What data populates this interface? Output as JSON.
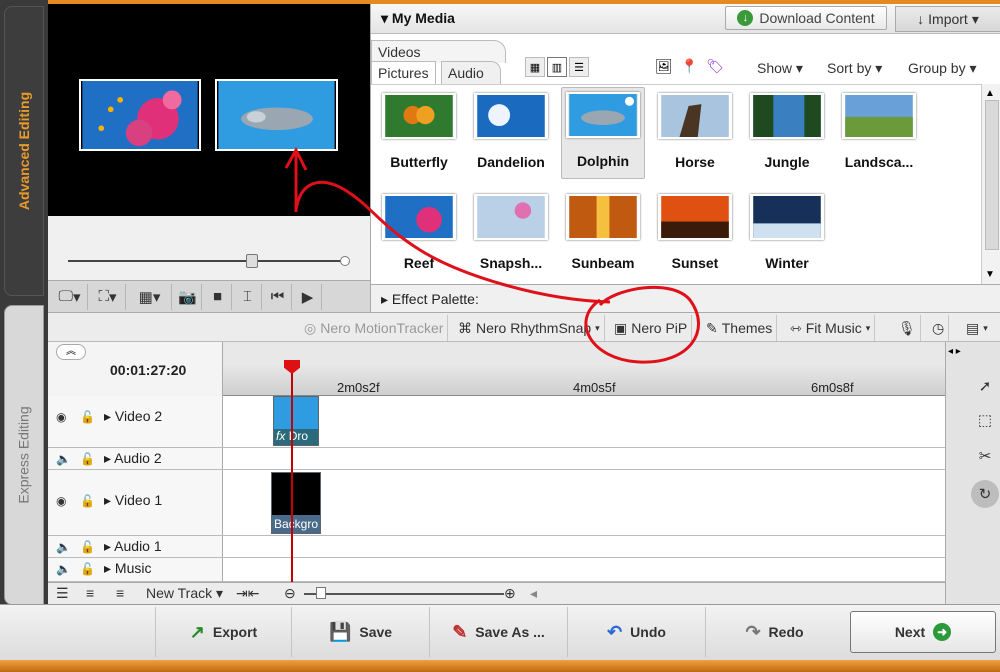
{
  "side_tabs": {
    "advanced": "Advanced Editing",
    "express": "Express Editing"
  },
  "media": {
    "title": "My Media",
    "download": "Download Content",
    "import": "Import",
    "tabs": {
      "videos": "Videos",
      "pictures": "Pictures",
      "audio": "Audio"
    },
    "show": "Show",
    "sort_by": "Sort by",
    "group_by": "Group by",
    "items": [
      {
        "label": "Butterfly"
      },
      {
        "label": "Dandelion"
      },
      {
        "label": "Dolphin"
      },
      {
        "label": "Horse"
      },
      {
        "label": "Jungle"
      },
      {
        "label": "Landsca..."
      },
      {
        "label": "Reef"
      },
      {
        "label": "Snapsh..."
      },
      {
        "label": "Sunbeam"
      },
      {
        "label": "Sunset"
      },
      {
        "label": "Winter"
      }
    ],
    "effect_palette": "Effect Palette:"
  },
  "toolbar": {
    "motion_tracker": "Nero MotionTracker",
    "rhythm_snap": "Nero RhythmSnap",
    "pip": "Nero PiP",
    "themes": "Themes",
    "fit_music": "Fit Music"
  },
  "timeline": {
    "timecode": "00:01:27:20",
    "ruler": [
      "2m0s2f",
      "4m0s5f",
      "6m0s8f"
    ],
    "tracks": [
      {
        "name": "Video 2"
      },
      {
        "name": "Audio 2"
      },
      {
        "name": "Video 1"
      },
      {
        "name": "Audio 1"
      },
      {
        "name": "Music"
      }
    ],
    "clip_video2": "Dro",
    "clip_video2_fx": "fx",
    "clip_video1": "Backgro",
    "new_track": "New Track"
  },
  "actions": {
    "export": "Export",
    "save": "Save",
    "save_as": "Save As ...",
    "undo": "Undo",
    "redo": "Redo",
    "next": "Next"
  }
}
